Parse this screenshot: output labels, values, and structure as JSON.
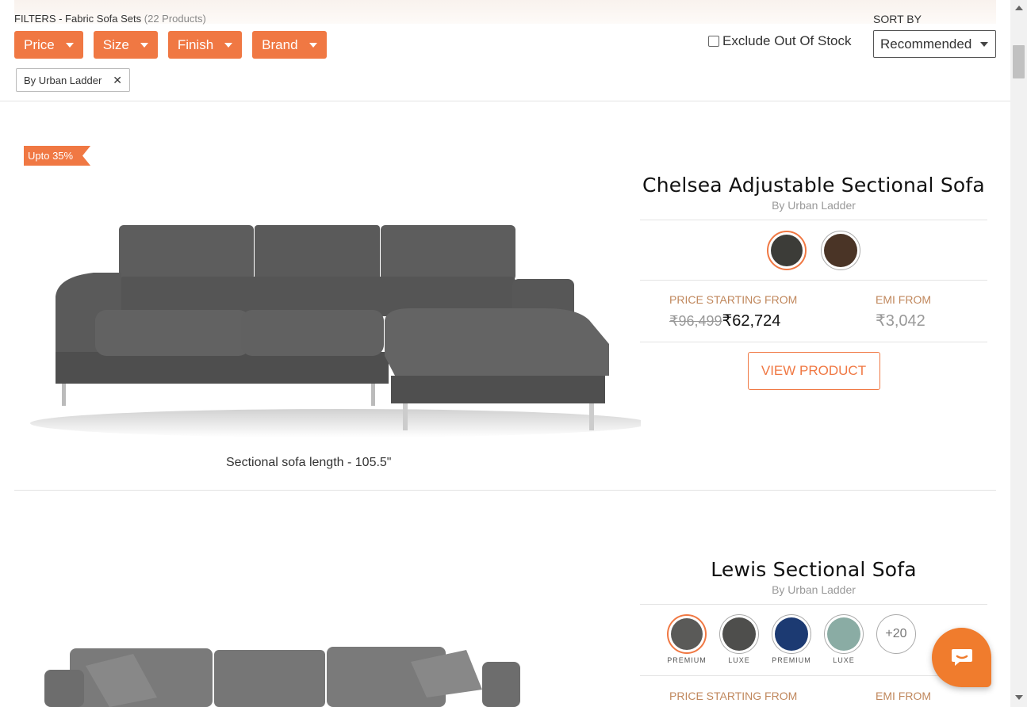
{
  "filters": {
    "title_prefix": "FILTERS - ",
    "category": "Fabric Sofa Sets",
    "count": "(22 Products)",
    "buttons": [
      {
        "label": "Price"
      },
      {
        "label": "Size"
      },
      {
        "label": "Finish"
      },
      {
        "label": "Brand"
      }
    ],
    "applied_chip": "By Urban Ladder",
    "exclude_out_of_stock": "Exclude Out Of Stock",
    "exclude_checked": false
  },
  "sort": {
    "label": "SORT BY",
    "selected": "Recommended"
  },
  "products": [
    {
      "badge": "Upto 35%",
      "name": "Chelsea Adjustable Sectional Sofa",
      "brand": "By Urban Ladder",
      "caption": "Sectional sofa length - 105.5\"",
      "swatches": [
        {
          "color": "#3c3c38",
          "label": ""
        },
        {
          "color": "#4a3426",
          "label": ""
        }
      ],
      "price_label": "PRICE STARTING FROM",
      "mrp": "₹96,499",
      "price": "₹62,724",
      "emi_label": "EMI FROM",
      "emi": "₹3,042",
      "cta": "VIEW PRODUCT"
    },
    {
      "name": "Lewis Sectional Sofa",
      "brand": "By Urban Ladder",
      "swatches": [
        {
          "color": "#5a5a58",
          "label": "PREMIUM"
        },
        {
          "color": "#4e4e4c",
          "label": "LUXE"
        },
        {
          "color": "#1c3a72",
          "label": "PREMIUM"
        },
        {
          "color": "#8aaca4",
          "label": "LUXE"
        }
      ],
      "more_swatches": "+20",
      "price_label": "PRICE STARTING FROM",
      "emi_label": "EMI FROM"
    }
  ],
  "colors": {
    "accent": "#f07843",
    "chat": "#f07c2d"
  }
}
